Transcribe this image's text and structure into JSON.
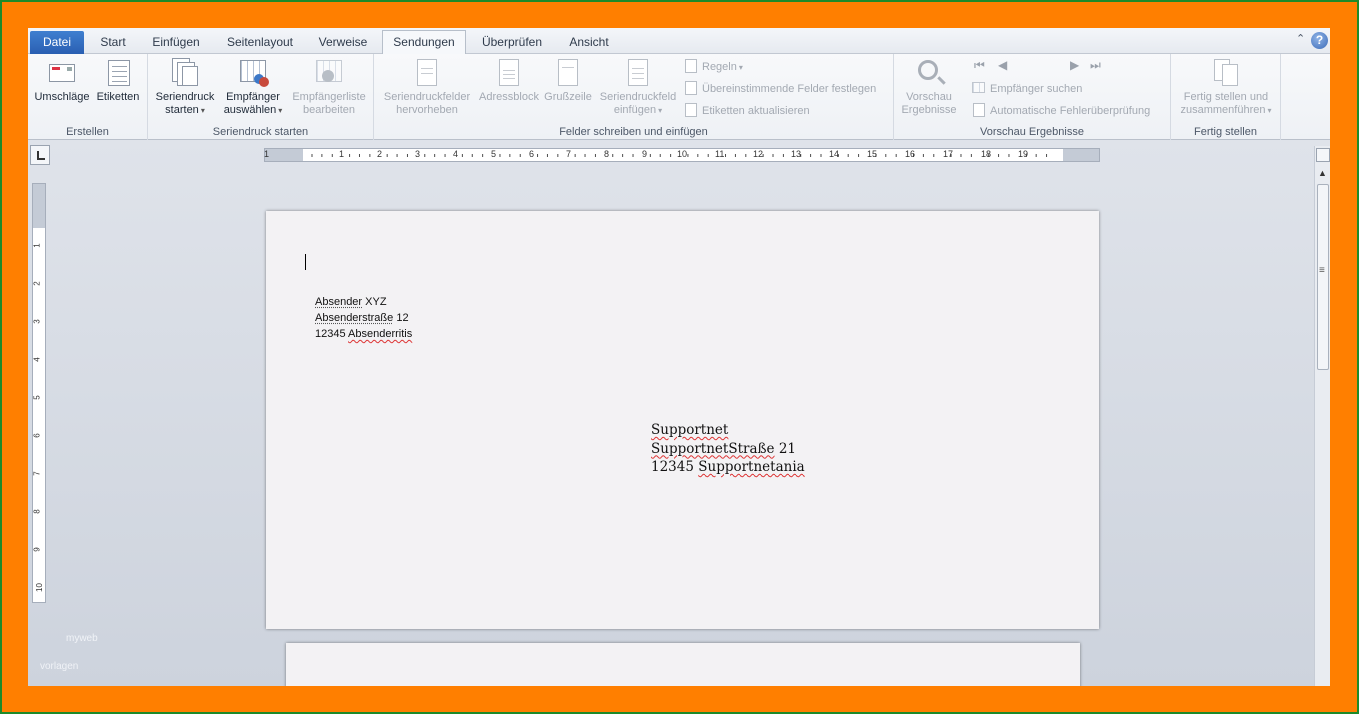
{
  "tabs": [
    {
      "label": "Datei"
    },
    {
      "label": "Start"
    },
    {
      "label": "Einfügen"
    },
    {
      "label": "Seitenlayout"
    },
    {
      "label": "Verweise"
    },
    {
      "label": "Sendungen"
    },
    {
      "label": "Überprüfen"
    },
    {
      "label": "Ansicht"
    }
  ],
  "active_tab": "Sendungen",
  "ribbon": {
    "erstellen": {
      "label": "Erstellen",
      "umschlaege": "Umschläge",
      "etiketten": "Etiketten"
    },
    "seriendruck": {
      "label": "Seriendruck starten",
      "starten_l1": "Seriendruck",
      "starten_l2": "starten",
      "empfaenger_l1": "Empfänger",
      "empfaenger_l2": "auswählen",
      "liste_l1": "Empfängerliste",
      "liste_l2": "bearbeiten"
    },
    "felder": {
      "label": "Felder schreiben und einfügen",
      "hervorheben_l1": "Seriendruckfelder",
      "hervorheben_l2": "hervorheben",
      "adressblock": "Adressblock",
      "grusszeile": "Grußzeile",
      "einfuegen_l1": "Seriendruckfeld",
      "einfuegen_l2": "einfügen",
      "regeln": "Regeln",
      "felder_festlegen": "Übereinstimmende Felder festlegen",
      "etiketten_aktualisieren": "Etiketten aktualisieren"
    },
    "vorschau": {
      "label": "Vorschau Ergebnisse",
      "vorschau_l1": "Vorschau",
      "vorschau_l2": "Ergebnisse",
      "empfaenger_suchen": "Empfänger suchen",
      "fehlerpruefung": "Automatische Fehlerüberprüfung"
    },
    "fertig": {
      "label": "Fertig stellen",
      "fertig_l1": "Fertig stellen und",
      "fertig_l2": "zusammenführen"
    }
  },
  "ruler": {
    "h_numbers": [
      "1",
      "1",
      "2",
      "3",
      "4",
      "5",
      "6",
      "7",
      "8",
      "9",
      "10",
      "11",
      "12",
      "13",
      "14",
      "15",
      "16",
      "17",
      "18",
      "19"
    ],
    "v_numbers": [
      "1",
      "2",
      "3",
      "4",
      "5",
      "6",
      "7",
      "8",
      "9",
      "10"
    ]
  },
  "document": {
    "sender": {
      "line1_a": "Absender",
      "line1_b": " XYZ",
      "line2_a": "Absenderstraße",
      "line2_b": " 12",
      "line3_a": "12345 ",
      "line3_b": "Absenderritis"
    },
    "recipient": {
      "line1": "Supportnet",
      "line2_a": "SupportnetStraße",
      "line2_b": " 21",
      "line3_a": "12345 ",
      "line3_b": "Supportnetania"
    }
  },
  "watermark": {
    "line1": "myweb",
    "line2": "vorlagen"
  },
  "colors": {
    "outer_border": "#ff7f00",
    "frame": "#1e8a2a",
    "file_tab": "#2a5fb2"
  }
}
